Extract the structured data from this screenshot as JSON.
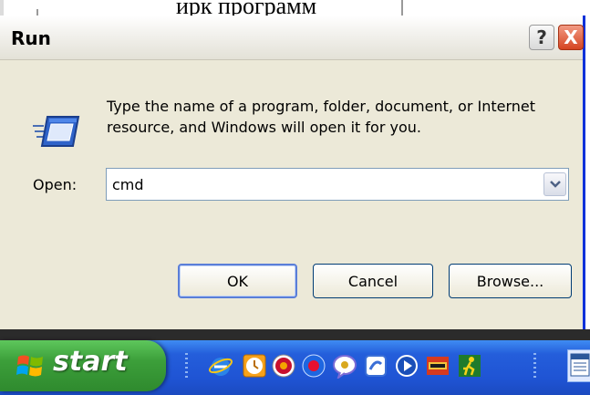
{
  "background_document": {
    "visible_text": "ирк программ"
  },
  "dialog": {
    "title": "Run",
    "help_button": "?",
    "close_button": "X",
    "description": "Type the name of a program, folder, document, or Internet resource, and Windows will open it for you.",
    "open_label": "Open:",
    "open_value": "cmd",
    "buttons": {
      "ok": "OK",
      "cancel": "Cancel",
      "browse": "Browse..."
    }
  },
  "taskbar": {
    "start_label": "start",
    "quick_launch_icons": [
      "internet-explorer-icon",
      "clock-icon",
      "media-icon",
      "globe-icon",
      "messenger-icon",
      "app-icon",
      "media-player-icon",
      "game-icon",
      "running-man-icon"
    ]
  },
  "colors": {
    "title_bar_bg": "#f3f2ee",
    "dialog_bg": "#ece9d8",
    "taskbar_blue": "#245edb",
    "start_green": "#3c9f3a",
    "close_red": "#d54421",
    "window_border": "#0831d9"
  }
}
